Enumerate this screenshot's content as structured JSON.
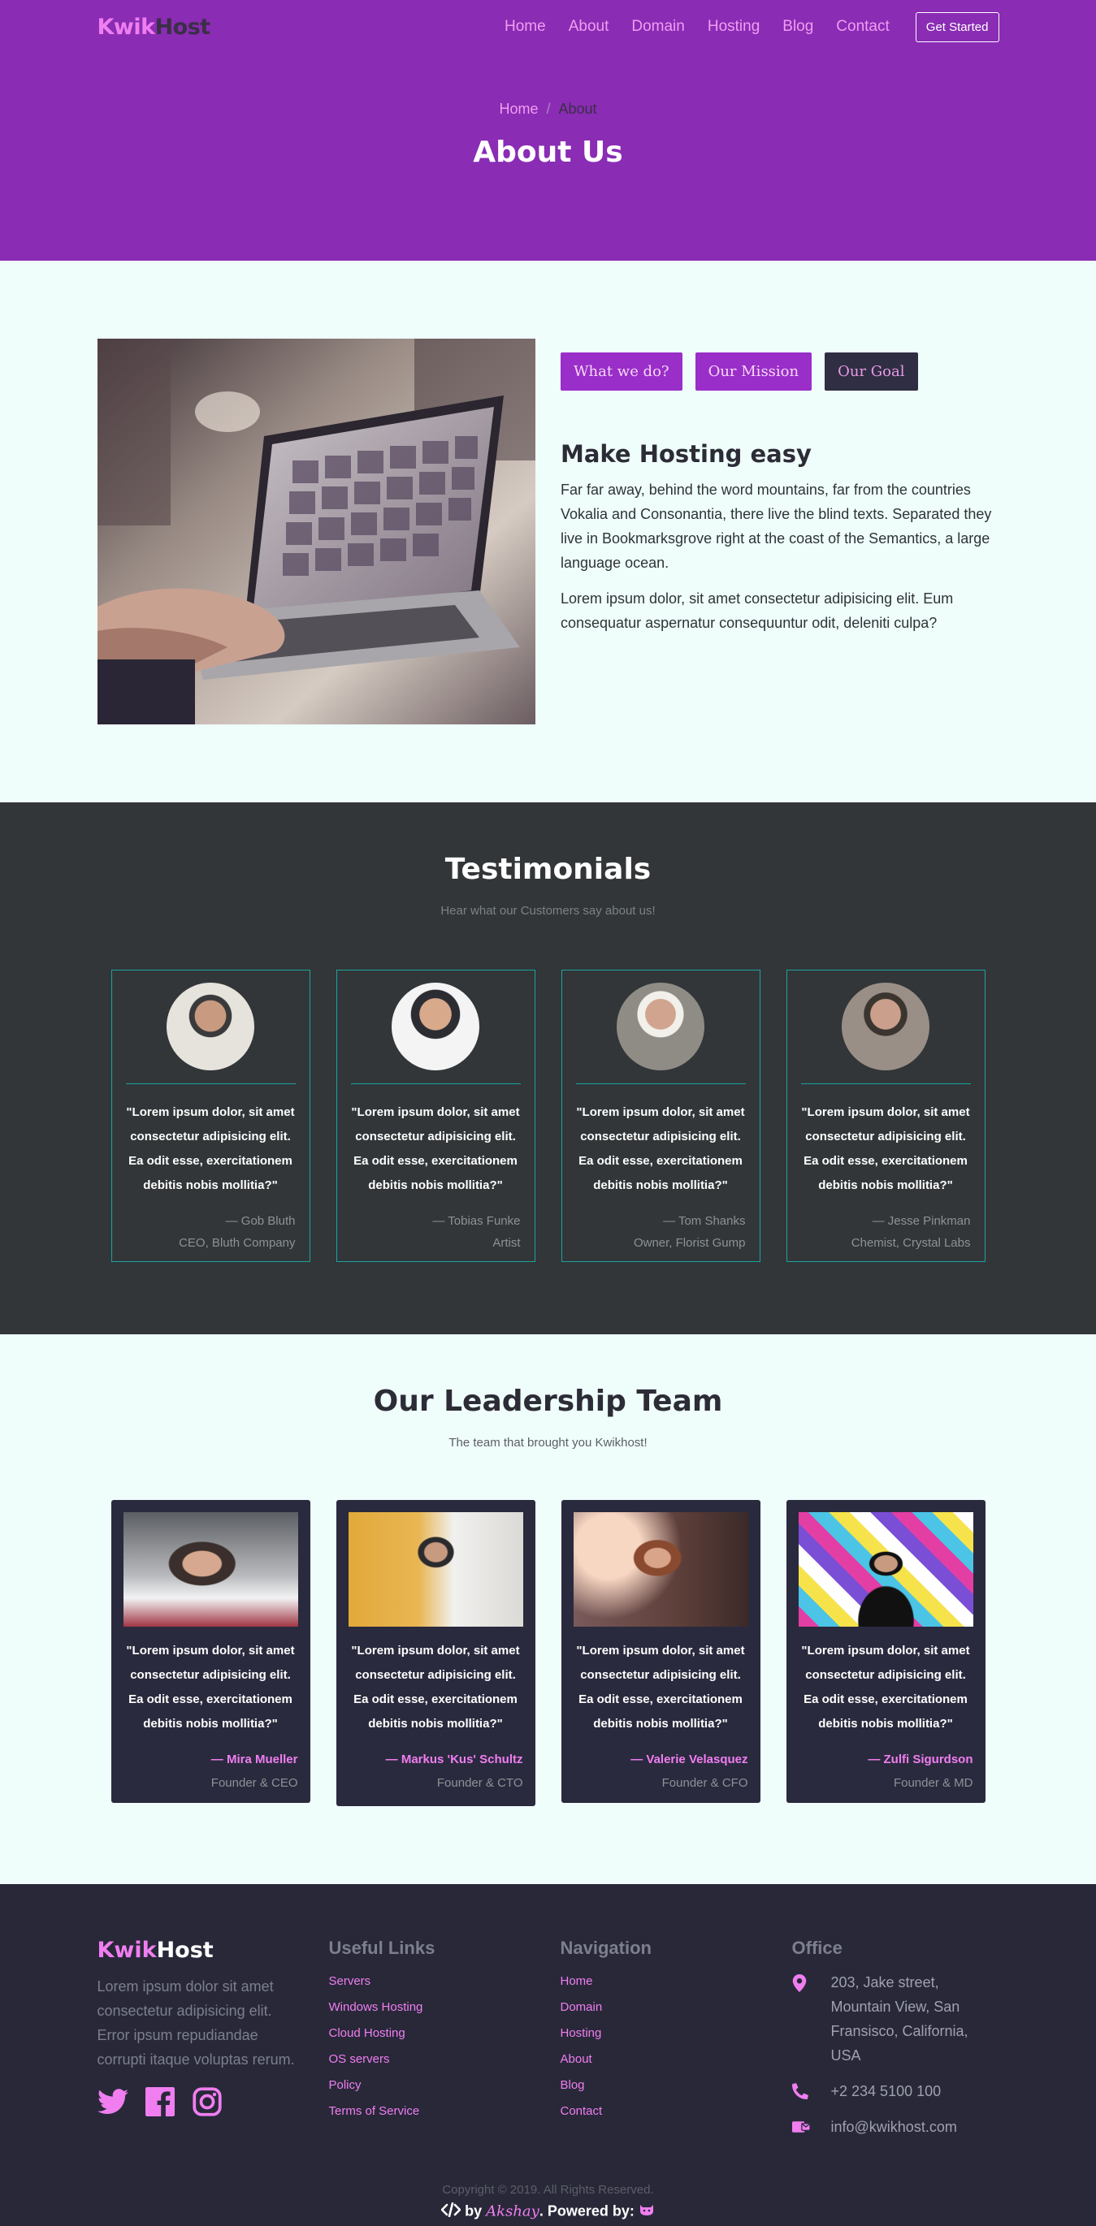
{
  "brand": {
    "kwik": "Kwik",
    "host": "Host"
  },
  "nav": {
    "items": [
      "Home",
      "About",
      "Domain",
      "Hosting",
      "Blog",
      "Contact"
    ],
    "cta": "Get Started"
  },
  "hero": {
    "breadcrumb_home": "Home",
    "breadcrumb_sep": "/",
    "breadcrumb_current": "About",
    "title": "About Us"
  },
  "about": {
    "tabs": [
      "What we do?",
      "Our Mission",
      "Our Goal"
    ],
    "active_tab": "Our Goal",
    "heading": "Make Hosting easy",
    "paragraph1": "Far far away, behind the word mountains, far from the countries Vokalia and Consonantia, there live the blind texts. Separated they live in Bookmarksgrove right at the coast of the Semantics, a large language ocean.",
    "paragraph2": "Lorem ipsum dolor, sit amet consectetur adipisicing elit. Eum consequatur aspernatur consequuntur odit, deleniti culpa?"
  },
  "testimonials": {
    "title": "Testimonials",
    "subtitle": "Hear what our Customers say about us!",
    "items": [
      {
        "quote": "\"Lorem ipsum dolor, sit amet consectetur adipisicing elit. Ea odit esse, exercitationem debitis nobis mollitia?\"",
        "name": "— Gob Bluth",
        "role": "CEO, Bluth Company"
      },
      {
        "quote": "\"Lorem ipsum dolor, sit amet consectetur adipisicing elit. Ea odit esse, exercitationem debitis nobis mollitia?\"",
        "name": "— Tobias Funke",
        "role": "Artist"
      },
      {
        "quote": "\"Lorem ipsum dolor, sit amet consectetur adipisicing elit. Ea odit esse, exercitationem debitis nobis mollitia?\"",
        "name": "— Tom Shanks",
        "role": "Owner, Florist Gump"
      },
      {
        "quote": "\"Lorem ipsum dolor, sit amet consectetur adipisicing elit. Ea odit esse, exercitationem debitis nobis mollitia?\"",
        "name": "— Jesse Pinkman",
        "role": "Chemist, Crystal Labs"
      }
    ]
  },
  "leadership": {
    "title": "Our Leadership Team",
    "subtitle": "The team that brought you Kwikhost!",
    "members": [
      {
        "quote": "\"Lorem ipsum dolor, sit amet consectetur adipisicing elit. Ea odit esse, exercitationem debitis nobis mollitia?\"",
        "name": "— Mira Mueller",
        "role": "Founder & CEO"
      },
      {
        "quote": "\"Lorem ipsum dolor, sit amet consectetur adipisicing elit. Ea odit esse, exercitationem debitis nobis mollitia?\"",
        "name": "— Markus 'Kus' Schultz",
        "role": "Founder & CTO"
      },
      {
        "quote": "\"Lorem ipsum dolor, sit amet consectetur adipisicing elit. Ea odit esse, exercitationem debitis nobis mollitia?\"",
        "name": "— Valerie Velasquez",
        "role": "Founder & CFO"
      },
      {
        "quote": "\"Lorem ipsum dolor, sit amet consectetur adipisicing elit. Ea odit esse, exercitationem debitis nobis mollitia?\"",
        "name": "— Zulfi Sigurdson",
        "role": "Founder & MD"
      }
    ]
  },
  "footer": {
    "description": "Lorem ipsum dolor sit amet consectetur adipisicing elit. Error ipsum repudiandae corrupti itaque voluptas rerum.",
    "social_icons": [
      "twitter-icon",
      "facebook-icon",
      "instagram-icon"
    ],
    "useful_links_title": "Useful Links",
    "useful_links": [
      "Servers",
      "Windows Hosting",
      "Cloud Hosting",
      "OS servers",
      "Policy",
      "Terms of Service"
    ],
    "navigation_title": "Navigation",
    "navigation_links": [
      "Home",
      "Domain",
      "Hosting",
      "About",
      "Blog",
      "Contact"
    ],
    "office_title": "Office",
    "address": "203, Jake street, Mountain View, San Fransisco, California, USA",
    "phone": "+2 234 5100 100",
    "email": "info@kwikhost.com",
    "copyright": "Copyright © 2019. All Rights Reserved.",
    "credit_by": "by",
    "credit_author": "Akshay",
    "credit_powered": ". Powered by:"
  },
  "colors": {
    "hero_bg": "#8a2cb4",
    "accent_pink": "#f07ef0",
    "tab_bg": "#9a2ec8",
    "dark_section": "#323638",
    "footer_bg": "#282839",
    "teal_border": "#1aa3a0"
  }
}
